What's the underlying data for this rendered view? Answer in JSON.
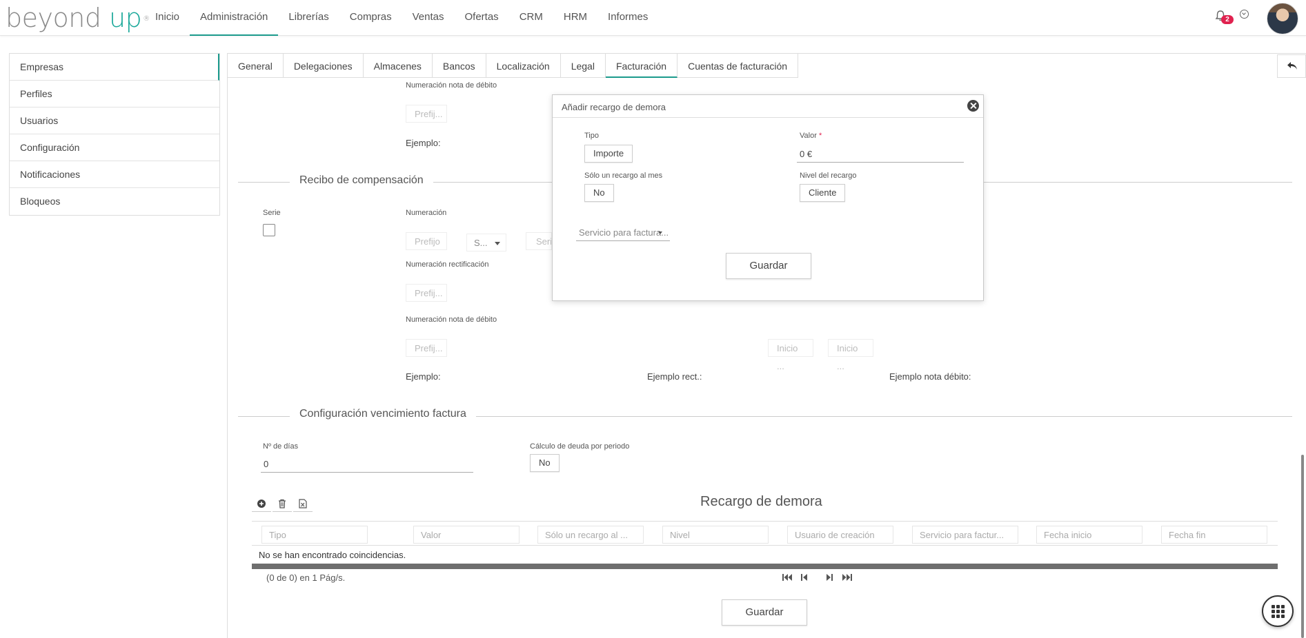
{
  "brand": {
    "logo_left": "beyond",
    "logo_right": "up",
    "logo_reg": "®",
    "accent": "#1a9a8c",
    "logo_accent": "#1aa89a"
  },
  "topnav": {
    "items": [
      "Inicio",
      "Administración",
      "Librerías",
      "Compras",
      "Ventas",
      "Ofertas",
      "CRM",
      "HRM",
      "Informes"
    ],
    "active": "Administración",
    "notifications_count": "2",
    "icons": [
      "bell-icon",
      "chevron-circle-icon",
      "avatar"
    ]
  },
  "sidebar": {
    "items": [
      "Empresas",
      "Perfiles",
      "Usuarios",
      "Configuración",
      "Notificaciones",
      "Bloqueos"
    ],
    "active": "Empresas"
  },
  "tabs": {
    "items": [
      "General",
      "Delegaciones",
      "Almacenes",
      "Bancos",
      "Localización",
      "Legal",
      "Facturación",
      "Cuentas de facturación"
    ],
    "active": "Facturación",
    "back_icon": "undo-arrow-icon"
  },
  "top_block": {
    "debit_label": "Numeración nota de débito",
    "prefix_placeholder": "Prefij...",
    "example_label": "Ejemplo:"
  },
  "recibo": {
    "title": "Recibo de compensación",
    "serie_label": "Serie",
    "numeracion_label": "Numeración",
    "prefijo_placeholder": "Prefijo",
    "select_placeholder": "S...",
    "serie_placeholder": "Seri",
    "rect_label": "Numeración rectificación",
    "rect_prefix": "Prefij...",
    "debit_label": "Numeración nota de débito",
    "debit_prefix": "Prefij...",
    "inicio_1": "Inicio ...",
    "inicio_2": "Inicio ...",
    "example_label": "Ejemplo:",
    "example_rect_label": "Ejemplo rect.:",
    "example_debit_label": "Ejemplo nota débito:"
  },
  "vencimiento": {
    "title": "Configuración vencimiento factura",
    "days_label": "Nº de días",
    "days_value": "0",
    "calc_label": "Cálculo de deuda por periodo",
    "calc_value": "No"
  },
  "grid": {
    "title": "Recargo de demora",
    "toolbar_icons": [
      "add-icon",
      "delete-icon",
      "excel-export-icon"
    ],
    "columns": [
      "Tipo",
      "Valor",
      "Sólo un recargo al ...",
      "Nivel",
      "Usuario de creación",
      "Servicio para factur...",
      "Fecha inicio",
      "Fecha fin"
    ],
    "empty_message": "No se han encontrado coincidencias.",
    "paging_text": "(0 de 0) en 1 Pág/s."
  },
  "save_label": "Guardar",
  "modal": {
    "title": "Añadir recargo de demora",
    "tipo_label": "Tipo",
    "tipo_value": "Importe",
    "valor_label": "Valor",
    "valor_required": "*",
    "valor_value": "0 €",
    "solo_label": "Sólo un recargo al mes",
    "solo_value": "No",
    "nivel_label": "Nivel del recargo",
    "nivel_value": "Cliente",
    "servicio_placeholder": "Servicio para factura...",
    "save_label": "Guardar"
  }
}
